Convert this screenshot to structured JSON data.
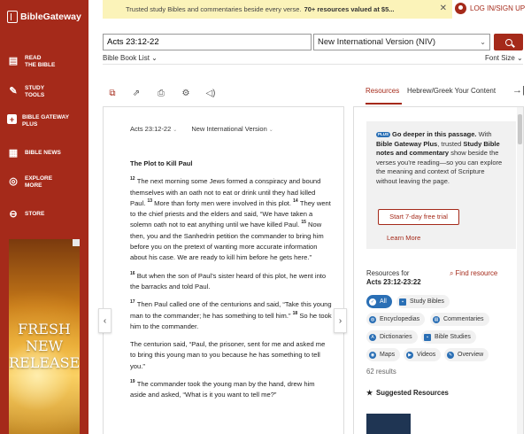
{
  "brand": {
    "name": "BibleGateway"
  },
  "sidebar": {
    "items": [
      {
        "label": "READ\nTHE BIBLE",
        "icon": "book-icon"
      },
      {
        "label": "STUDY\nTOOLS",
        "icon": "study-tools-icon"
      },
      {
        "label": "BIBLE GATEWAY\nPLUS",
        "icon": "plus-icon"
      },
      {
        "label": "BIBLE NEWS",
        "icon": "news-icon"
      },
      {
        "label": "EXPLORE\nMORE",
        "icon": "compass-icon"
      },
      {
        "label": "STORE",
        "icon": "store-icon"
      }
    ],
    "ad": {
      "lines": [
        "FRESH",
        "NEW",
        "RELEASES"
      ]
    }
  },
  "banner": {
    "text": "Trusted study Bibles and commentaries beside every verse.",
    "bold": "70+ resources valued at $5...",
    "close": "✕"
  },
  "login": {
    "label": "LOG IN/SIGN UP"
  },
  "search": {
    "value": "Acts 23:12-22",
    "version": "New International Version (NIV)"
  },
  "links": {
    "book_list": "Bible Book List",
    "font_size": "Font Size"
  },
  "right_tabs": {
    "resources": "Resources",
    "content": "Hebrew/Greek Your Content"
  },
  "reader": {
    "ref": "Acts 23:12-22",
    "version": "New International Version",
    "heading": "The Plot to Kill Paul",
    "paragraphs": [
      [
        {
          "v": "12",
          "t": "The next morning some Jews formed a conspiracy and bound themselves with an oath not to eat or drink until they had killed Paul."
        },
        {
          "v": "13",
          "t": "More than forty men were involved in this plot."
        },
        {
          "v": "14",
          "t": "They went to the chief priests and the elders and said, “We have taken a solemn oath not to eat anything until we have killed Paul."
        },
        {
          "v": "15",
          "t": "Now then, you and the Sanhedrin petition the commander to bring him before you on the pretext of wanting more accurate information about his case. We are ready to kill him before he gets here.”"
        }
      ],
      [
        {
          "v": "16",
          "t": "But when the son of Paul’s sister heard of this plot, he went into the barracks and told Paul."
        }
      ],
      [
        {
          "v": "17",
          "t": "Then Paul called one of the centurions and said, “Take this young man to the commander; he has something to tell him.”"
        },
        {
          "v": "18",
          "t": "So he took him to the commander."
        }
      ],
      [
        {
          "v": "",
          "t": "The centurion said, “Paul, the prisoner, sent for me and asked me to bring this young man to you because he has something to tell you.”"
        }
      ],
      [
        {
          "v": "19",
          "t": "The commander took the young man by the hand, drew him aside and asked, “What is it you want to tell me?”"
        }
      ]
    ]
  },
  "promo": {
    "badge": "PLUS",
    "title": "Go deeper in this passage.",
    "pre": "With",
    "brand": "Bible Gateway Plus",
    "mid": ", trusted",
    "bold2": "Study Bible notes and commentary",
    "post": "show beside the verses you’re reading—so you can explore the meaning and context of Scripture without leaving the page.",
    "trial_label": "Start 7-day free trial",
    "learn_label": "Learn More"
  },
  "resources": {
    "for_label": "Resources for",
    "for_ref": "Acts 23:12-23:22",
    "find_label": "Find resource",
    "chips": [
      {
        "label": "All",
        "icon": "check-icon",
        "active": true
      },
      {
        "label": "Study Bibles",
        "icon": "bible-icon"
      },
      {
        "label": "Encyclopedias",
        "icon": "globe-icon"
      },
      {
        "label": "Commentaries",
        "icon": "commentary-icon"
      },
      {
        "label": "Dictionaries",
        "icon": "dictionary-icon"
      },
      {
        "label": "Bible Studies",
        "icon": "bible-study-icon"
      },
      {
        "label": "Maps",
        "icon": "map-icon"
      },
      {
        "label": "Videos",
        "icon": "video-icon"
      },
      {
        "label": "Overview",
        "icon": "overview-icon"
      }
    ],
    "count": "62 results",
    "suggested": "Suggested Resources"
  },
  "colors": {
    "brand": "#a52a1a",
    "banner": "#fbf3b9",
    "chip_active": "#2a6fb5"
  }
}
